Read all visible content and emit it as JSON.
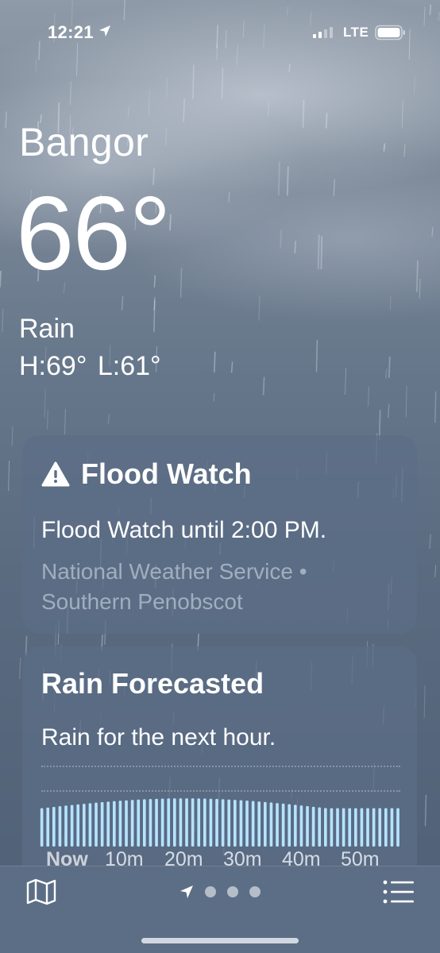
{
  "status_bar": {
    "time": "12:21",
    "network": "LTE",
    "icons": [
      "location-arrow-icon",
      "cellular-signal-icon",
      "battery-icon"
    ]
  },
  "header": {
    "city": "Bangor",
    "temperature": "66°",
    "condition": "Rain",
    "high_low": "H:69°  L:61°"
  },
  "flood_watch": {
    "title": "Flood Watch",
    "icon": "warning-triangle-icon",
    "message": "Flood Watch until 2:00 PM.",
    "source": "National Weather Service • Southern Penobscot"
  },
  "rain_forecast": {
    "title": "Rain Forecasted",
    "message": "Rain for the next hour.",
    "timeline_labels": [
      "Now",
      "10m",
      "20m",
      "30m",
      "40m",
      "50m"
    ],
    "chart_color": "#b6e3ff"
  },
  "toolbar": {
    "map_icon": "map-icon",
    "list_icon": "list-icon",
    "pages": 3,
    "current_page_icon": "location-arrow-icon"
  },
  "colors": {
    "card_background": "#5c6e86",
    "secondary_text": "#aab6c6",
    "rain_bar": "#b6e3ff"
  }
}
